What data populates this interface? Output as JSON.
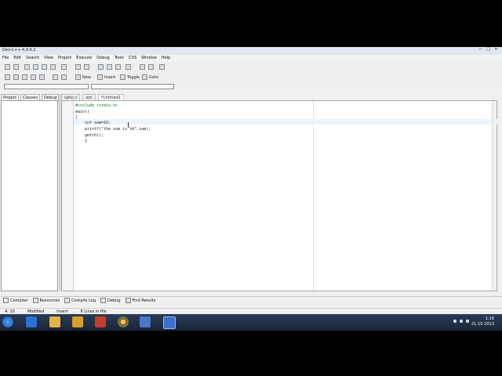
{
  "window": {
    "title": "Dev-C++ 4.9.9.2",
    "minimize": "—",
    "maximize": "□",
    "close": "✕"
  },
  "menu": [
    "File",
    "Edit",
    "Search",
    "View",
    "Project",
    "Execute",
    "Debug",
    "Tools",
    "CVS",
    "Window",
    "Help"
  ],
  "toolbar2": {
    "new": "New",
    "insert": "Insert",
    "toggle": "Toggle",
    "goto": "Goto"
  },
  "left_tabs": [
    "Project",
    "Classes",
    "Debug"
  ],
  "file_tabs": [
    "cpnc.c",
    "xcc",
    "*Untitled1"
  ],
  "code_lines": [
    "#include <stdio.h>",
    "main()",
    "{",
    "    int sum=10;",
    "    printf(\"the sum is %d\",sum);",
    "    getch();",
    "    }"
  ],
  "bottom_tabs": [
    "Compiler",
    "Resources",
    "Compile Log",
    "Debug",
    "Find Results"
  ],
  "status": {
    "position": "4: 10",
    "mode1": "Modified",
    "mode2": "Insert",
    "info": "8 Lines in file"
  },
  "tray": {
    "time": "1:16",
    "date": "21-10-2013"
  },
  "colors": {
    "taskbar": "#1b2536",
    "editor_bg": "#ffffff",
    "preprocessor": "#0a7a2a"
  }
}
